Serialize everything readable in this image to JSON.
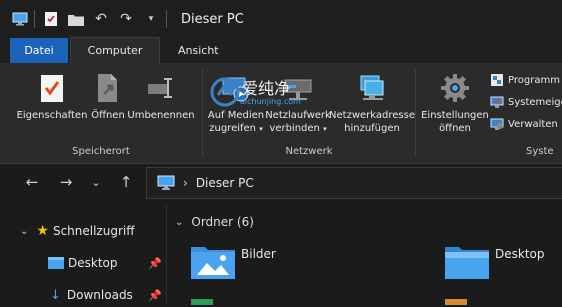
{
  "window": {
    "title": "Dieser PC"
  },
  "ribbon_tabs": {
    "file": "Datei",
    "computer": "Computer",
    "view": "Ansicht"
  },
  "ribbon": {
    "location": {
      "label": "Speicherort",
      "properties": "Eigenschaften",
      "open": "Öffnen",
      "rename": "Umbenennen"
    },
    "network": {
      "label": "Netzwerk",
      "media_line1": "Auf Medien",
      "media_line2": "zugreifen",
      "drive_line1": "Netzlaufwerk",
      "drive_line2": "verbinden",
      "address_line1": "Netzwerkadresse",
      "address_line2": "hinzufügen"
    },
    "system": {
      "label": "Syste",
      "settings_line1": "Einstellungen",
      "settings_line2": "öffnen",
      "programs": "Programm",
      "properties": "Systemeige",
      "manage": "Verwalten"
    }
  },
  "address": {
    "path": "Dieser PC"
  },
  "sidebar": {
    "quick_access": "Schnellzugriff",
    "items": [
      {
        "label": "Desktop"
      },
      {
        "label": "Downloads"
      }
    ]
  },
  "content": {
    "section": "Ordner (6)",
    "folders": [
      {
        "label": "Bilder"
      },
      {
        "label": "Desktop"
      }
    ]
  },
  "watermark": {
    "text": "爱纯净",
    "url": "aichunjing.com"
  },
  "colors": {
    "accent": "#1a63b8",
    "folder": "#4aa3ef",
    "background": "#1b1b1b"
  }
}
